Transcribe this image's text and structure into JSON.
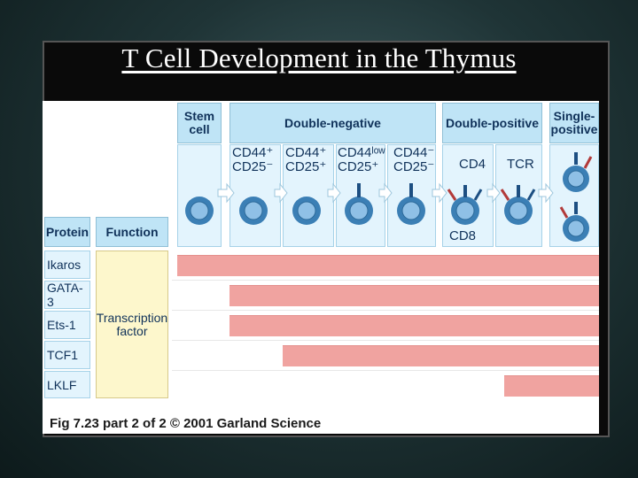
{
  "slide": {
    "title": "T Cell Development in the Thymus"
  },
  "figure": {
    "stage_headers": {
      "stem": "Stem\ncell",
      "double_negative": "Double-negative",
      "double_positive": "Double-positive",
      "single_positive": "Single-\npositive"
    },
    "markers": {
      "dn1": "CD44⁺\nCD25⁻",
      "dn2": "CD44⁺\nCD25⁺",
      "dn3": "CD44ˡᵒʷ\nCD25⁺",
      "dn4": "CD44⁻\nCD25⁻",
      "dp_cd4": "CD4",
      "dp_tcr": "TCR",
      "cd8": "CD8"
    },
    "table_headers": {
      "protein": "Protein",
      "function": "Function"
    },
    "proteins": [
      "Ikaros",
      "GATA-3",
      "Ets-1",
      "TCF1",
      "LKLF"
    ],
    "function_text": "Transcription\nfactor",
    "expression_stages": [
      "Stem cell",
      "CD44⁺ CD25⁻",
      "CD44⁺ CD25⁺",
      "CD44low CD25⁺",
      "CD44⁻ CD25⁻",
      "CD4",
      "TCR",
      "Single-positive"
    ],
    "expression_start_stage_index": [
      0,
      1,
      1,
      2,
      6
    ],
    "colors": {
      "header_blue": "#bfe4f6",
      "panel_blue": "#e3f4fd",
      "function_yellow": "#fdf7cc",
      "expression_bar": "#f0a3a0",
      "cell_membrane": "#3b7fb5",
      "cell_nucleus": "#6fa8d8"
    },
    "caption": "Fig 7.23 part 2 of 2  © 2001 Garland Science"
  }
}
